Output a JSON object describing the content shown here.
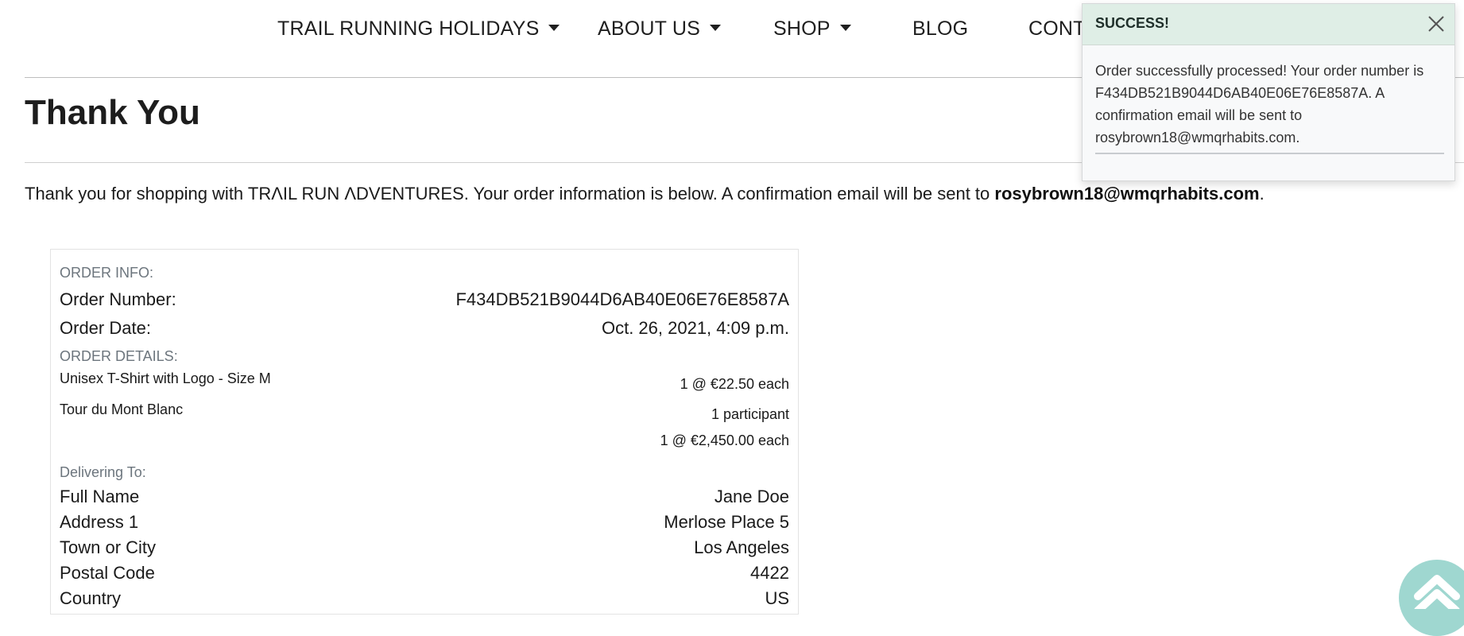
{
  "nav": {
    "items": [
      {
        "label": "TRAIL RUNNING HOLIDAYS",
        "dropdown": true
      },
      {
        "label": "ABOUT US",
        "dropdown": true
      },
      {
        "label": "SHOP",
        "dropdown": true
      },
      {
        "label": "BLOG",
        "dropdown": false
      },
      {
        "label": "CONTA",
        "dropdown": false
      }
    ]
  },
  "page": {
    "title": "Thank You",
    "intro_text": "Thank you for shopping with TRΛIL RUN ΛDVENTURES. Your order information is below. A confirmation email will be sent to ",
    "intro_email": "rosybrown18@wmqrhabits.com",
    "intro_end": "."
  },
  "order": {
    "info_heading": "ORDER INFO:",
    "number_label": "Order Number:",
    "number_value": "F434DB521B9044D6AB40E06E76E8587A",
    "date_label": "Order Date:",
    "date_value": "Oct. 26, 2021, 4:09 p.m.",
    "details_heading": "ORDER DETAILS:",
    "items": [
      {
        "name": "Unisex T-Shirt with Logo - Size M",
        "qty_price": "1 @ €22.50 each"
      },
      {
        "name": "Tour du Mont Blanc",
        "participants": "1 participant",
        "qty_price": "1 @ €2,450.00 each"
      }
    ],
    "delivery_heading": "Delivering To:",
    "delivery": [
      {
        "label": "Full Name",
        "value": "Jane Doe"
      },
      {
        "label": "Address 1",
        "value": "Merlose Place 5"
      },
      {
        "label": "Town or City",
        "value": "Los Angeles"
      },
      {
        "label": "Postal Code",
        "value": "4422"
      },
      {
        "label": "Country",
        "value": "US"
      }
    ]
  },
  "toast": {
    "title": "SUCCESS!",
    "message": "Order successfully processed! Your order number is F434DB521B9044D6AB40E06E76E8587A. A confirmation email will be sent to rosybrown18@wmqrhabits.com.",
    "header_color": "#dfeee6"
  },
  "colors": {
    "back_to_top": "#9fd7d0"
  }
}
